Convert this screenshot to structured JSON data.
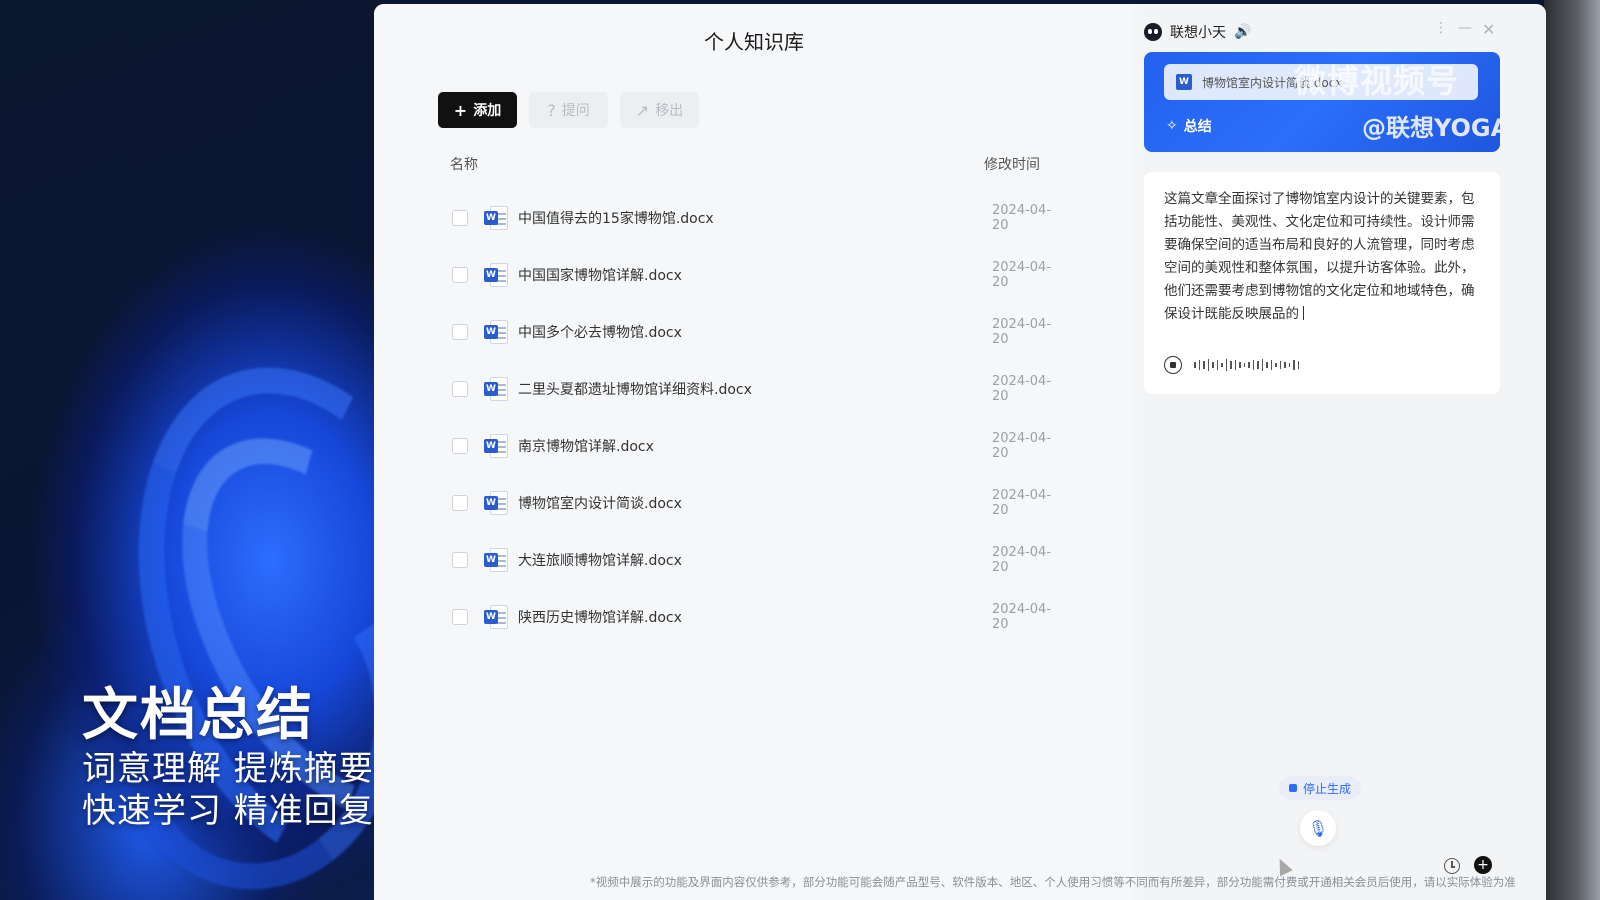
{
  "overlay": {
    "title": "文档总结",
    "subtitle_line1": "词意理解 提炼摘要",
    "subtitle_line2": "快速学习 精准回复"
  },
  "knowledge_base": {
    "title": "个人知识库",
    "toolbar": {
      "add_label": "添加",
      "ask_label": "提问",
      "remove_label": "移出"
    },
    "columns": {
      "name": "名称",
      "modified": "修改时间"
    },
    "files": [
      {
        "name": "中国值得去的15家博物馆.docx",
        "date": "2024-04-20"
      },
      {
        "name": "中国国家博物馆详解.docx",
        "date": "2024-04-20"
      },
      {
        "name": "中国多个必去博物馆.docx",
        "date": "2024-04-20"
      },
      {
        "name": "二里头夏都遗址博物馆详细资料.docx",
        "date": "2024-04-20"
      },
      {
        "name": "南京博物馆详解.docx",
        "date": "2024-04-20"
      },
      {
        "name": "博物馆室内设计简谈.docx",
        "date": "2024-04-20"
      },
      {
        "name": "大连旅顺博物馆详解.docx",
        "date": "2024-04-20"
      },
      {
        "name": "陕西历史博物馆详解.docx",
        "date": "2024-04-20"
      }
    ]
  },
  "assistant": {
    "name": "联想小天",
    "doc_chip": "博物馆室内设计简谈.docx",
    "summary_label": "总结",
    "watermark": "微博视频号",
    "watermark_handle": "@联想YOGA",
    "answer": "这篇文章全面探讨了博物馆室内设计的关键要素，包括功能性、美观性、文化定位和可持续性。设计师需要确保空间的适当布局和良好的人流管理，同时考虑空间的美观性和整体氛围，以提升访客体验。此外，他们还需要考虑到博物馆的文化定位和地域特色，确保设计既能反映展品的",
    "stop_label": "停止生成"
  },
  "disclaimer": "*视频中展示的功能及界面内容仅供参考，部分功能可能会随产品型号、软件版本、地区、个人使用习惯等不同而有所差异，部分功能需付费或开通相关会员后使用，请以实际体验为准"
}
